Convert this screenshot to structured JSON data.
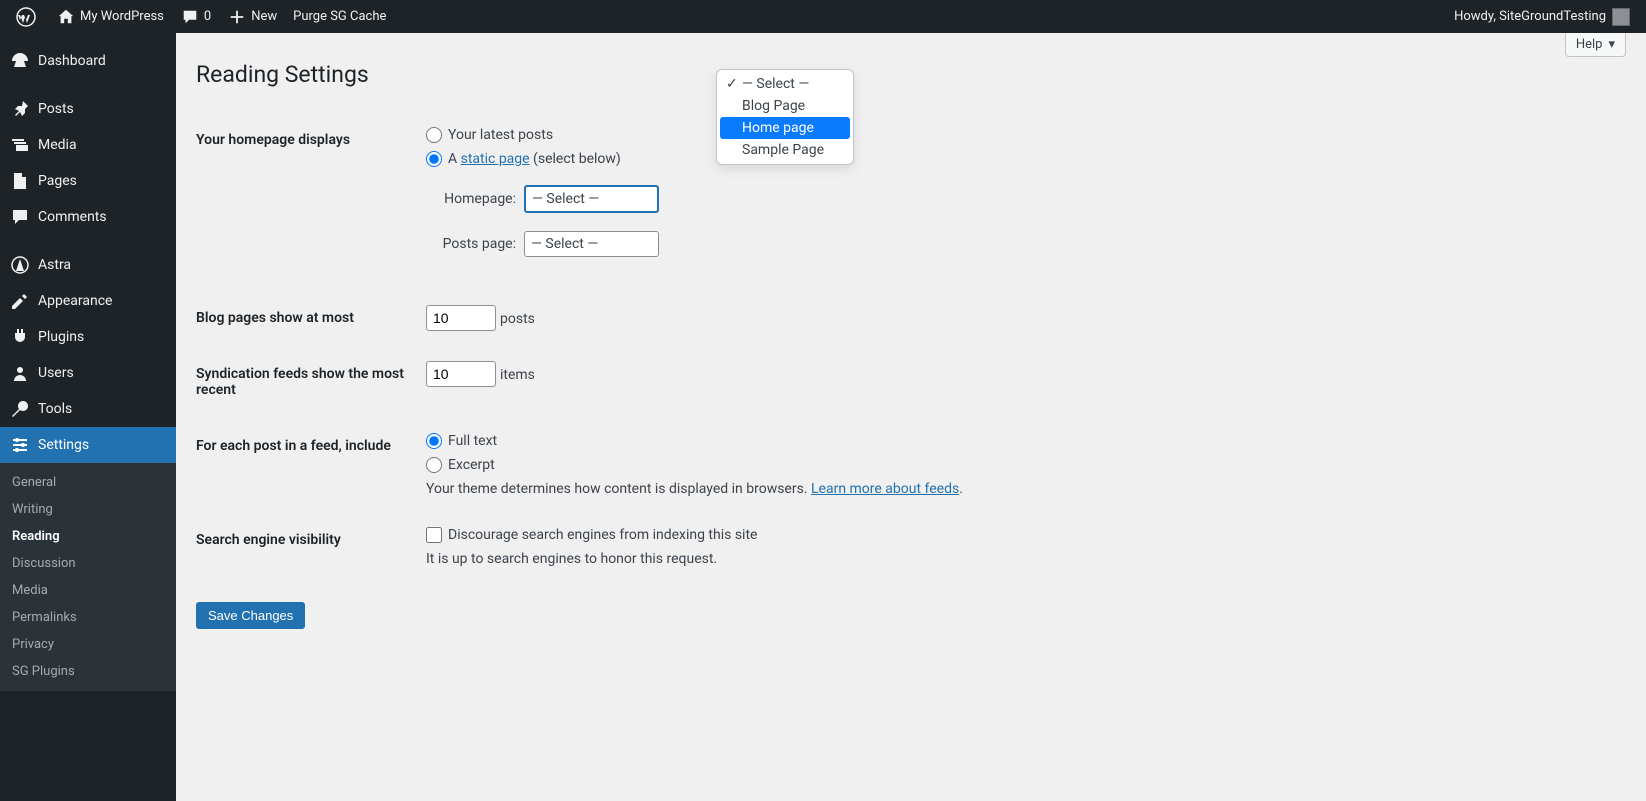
{
  "adminbar": {
    "site": "My WordPress",
    "comments": "0",
    "new": "New",
    "purge": "Purge SG Cache",
    "howdy": "Howdy, SiteGroundTesting"
  },
  "sidebar": {
    "items": [
      {
        "label": "Dashboard"
      },
      {
        "label": "Posts"
      },
      {
        "label": "Media"
      },
      {
        "label": "Pages"
      },
      {
        "label": "Comments"
      },
      {
        "label": "Astra"
      },
      {
        "label": "Appearance"
      },
      {
        "label": "Plugins"
      },
      {
        "label": "Users"
      },
      {
        "label": "Tools"
      },
      {
        "label": "Settings"
      }
    ],
    "submenu": [
      "General",
      "Writing",
      "Reading",
      "Discussion",
      "Media",
      "Permalinks",
      "Privacy",
      "SG Plugins"
    ]
  },
  "help": "Help",
  "page_title": "Reading Settings",
  "homepage": {
    "label": "Your homepage displays",
    "opt_latest": "Your latest posts",
    "opt_static_a": "A ",
    "opt_static_link": "static page",
    "opt_static_suffix": " (select below)",
    "homepage_label": "Homepage:",
    "posts_page_label": "Posts page:",
    "selected": "— Select —"
  },
  "dropdown": {
    "items": [
      "— Select —",
      "Blog Page",
      "Home page",
      "Sample Page"
    ]
  },
  "blog_pages": {
    "label": "Blog pages show at most",
    "value": "10",
    "suffix": "posts"
  },
  "syndication": {
    "label": "Syndication feeds show the most recent",
    "value": "10",
    "suffix": "items"
  },
  "feed": {
    "label": "For each post in a feed, include",
    "full": "Full text",
    "excerpt": "Excerpt",
    "desc_pre": "Your theme determines how content is displayed in browsers. ",
    "desc_link": "Learn more about feeds",
    "desc_post": "."
  },
  "search_engine": {
    "label": "Search engine visibility",
    "checkbox": "Discourage search engines from indexing this site",
    "desc": "It is up to search engines to honor this request."
  },
  "save": "Save Changes"
}
